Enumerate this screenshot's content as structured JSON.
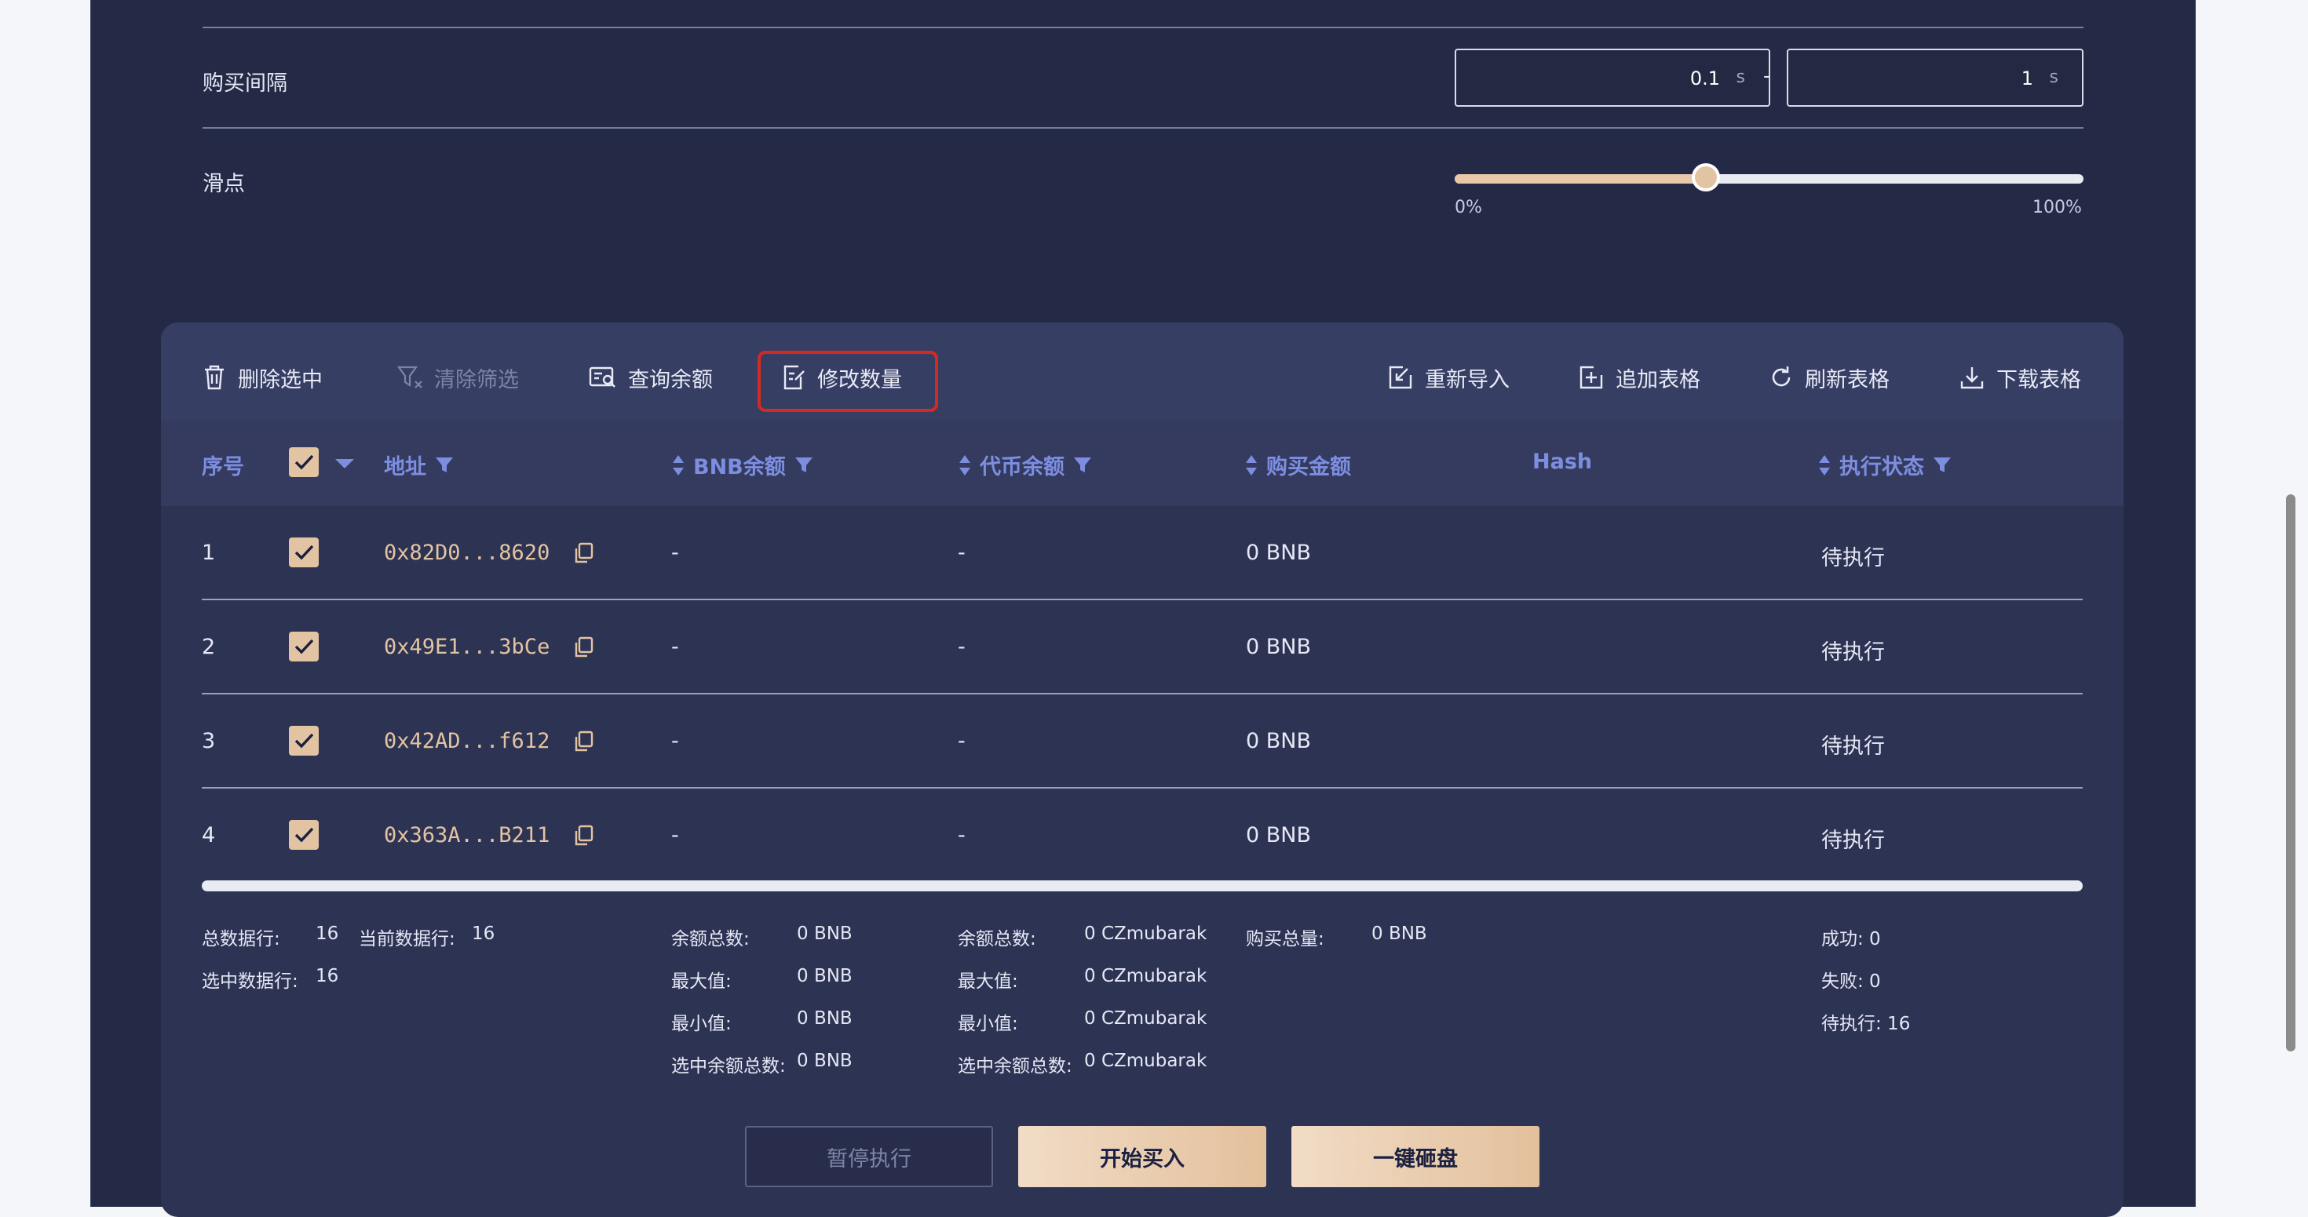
{
  "settings": {
    "interval_label": "购买间隔",
    "interval_min": "0.1",
    "interval_max": "1",
    "interval_unit": "s",
    "range_dash": "-",
    "slippage_label": "滑点",
    "slippage_value_percent": 40,
    "slider_min_label": "0%",
    "slider_max_label": "100%"
  },
  "toolbar": {
    "delete_selected": "删除选中",
    "clear_filter": "清除筛选",
    "query_balance": "查询余额",
    "edit_amount": "修改数量",
    "reimport": "重新导入",
    "append_table": "追加表格",
    "refresh_table": "刷新表格",
    "download_table": "下载表格"
  },
  "table": {
    "headers": {
      "index": "序号",
      "address": "地址",
      "bnb_balance": "BNB余额",
      "token_balance": "代币余额",
      "buy_amount": "购买金额",
      "hash": "Hash",
      "status": "执行状态"
    },
    "rows": [
      {
        "index": "1",
        "address": "0x82D0...8620",
        "bnb": "-",
        "token": "-",
        "buy": "0 BNB",
        "hash": "",
        "status": "待执行"
      },
      {
        "index": "2",
        "address": "0x49E1...3bCe",
        "bnb": "-",
        "token": "-",
        "buy": "0 BNB",
        "hash": "",
        "status": "待执行"
      },
      {
        "index": "3",
        "address": "0x42AD...f612",
        "bnb": "-",
        "token": "-",
        "buy": "0 BNB",
        "hash": "",
        "status": "待执行"
      },
      {
        "index": "4",
        "address": "0x363A...B211",
        "bnb": "-",
        "token": "-",
        "buy": "0 BNB",
        "hash": "",
        "status": "待执行"
      }
    ]
  },
  "stats": {
    "total_rows_label": "总数据行:",
    "total_rows": "16",
    "current_rows_label": "当前数据行:",
    "current_rows": "16",
    "selected_rows_label": "选中数据行:",
    "selected_rows": "16",
    "bnb": {
      "total_label": "余额总数:",
      "total": "0 BNB",
      "max_label": "最大值:",
      "max": "0 BNB",
      "min_label": "最小值:",
      "min": "0 BNB",
      "selected_label": "选中余额总数:",
      "selected": "0 BNB"
    },
    "token": {
      "total_label": "余额总数:",
      "total": "0 CZmubarak",
      "max_label": "最大值:",
      "max": "0 CZmubarak",
      "min_label": "最小值:",
      "min": "0 CZmubarak",
      "selected_label": "选中余额总数:",
      "selected": "0 CZmubarak"
    },
    "buy_total_label": "购买总量:",
    "buy_total": "0 BNB",
    "success": "成功: 0",
    "failed": "失败: 0",
    "pending": "待执行: 16"
  },
  "actions": {
    "pause": "暂停执行",
    "start": "开始买入",
    "dump": "一键砸盘"
  },
  "colors": {
    "background": "#242a46",
    "panel": "#2d3353",
    "accent_gold": "#e3c4a2",
    "header_blue": "#7d8ee0",
    "highlight_red": "#d42a20"
  }
}
